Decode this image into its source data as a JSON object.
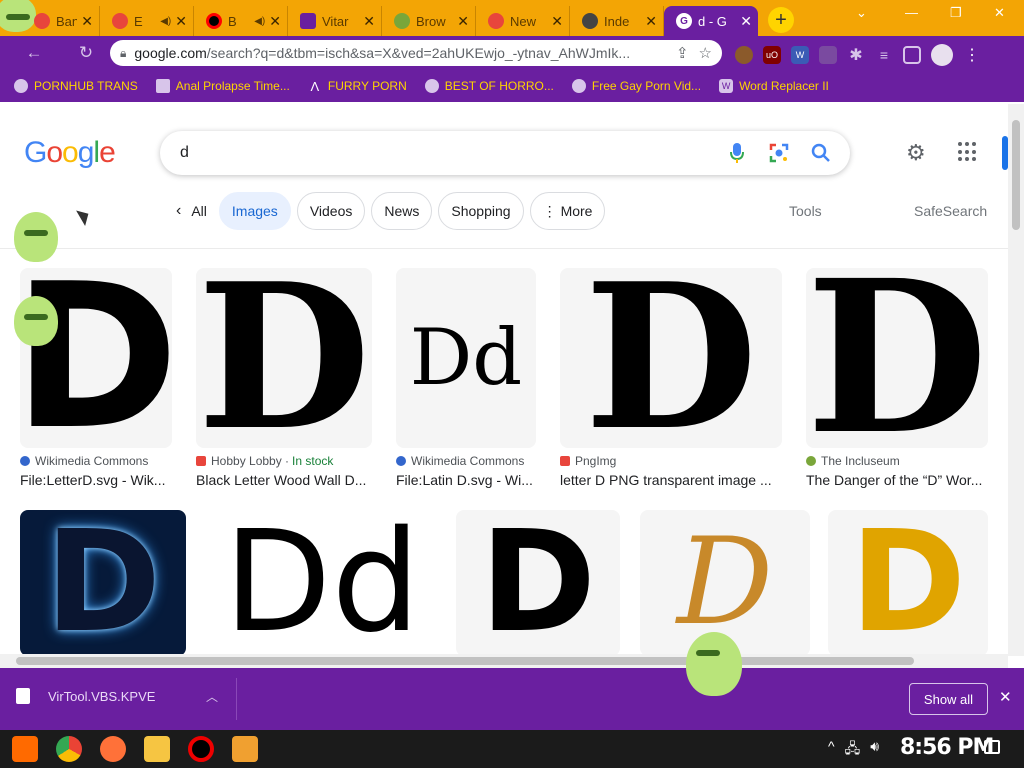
{
  "browser": {
    "tabs": [
      {
        "label": "Bandi",
        "color": "#e8453c"
      },
      {
        "label": "E",
        "color": "#e8453c"
      },
      {
        "label": "B",
        "color": "#ff0000"
      },
      {
        "label": "Vitar",
        "color": "#6a1fa0"
      },
      {
        "label": "Brow",
        "color": "#7aa63a"
      },
      {
        "label": "New",
        "color": "#e8453c"
      },
      {
        "label": "Inde",
        "color": "#444444"
      },
      {
        "label": "d - G",
        "color": "#ffffff"
      }
    ],
    "omnibox": {
      "host": "google.com",
      "path": "/search?q=d&tbm=isch&sa=X&ved=2ahUKEwjo_-ytnav_AhWJmIk..."
    },
    "bookmarks": [
      "PORNHUB TRANS",
      "Anal Prolapse Time...",
      "FURRY PORN",
      "BEST OF HORRO...",
      "Free Gay Porn Vid...",
      "Word Replacer II"
    ]
  },
  "google": {
    "query": "d",
    "chips": {
      "back": "All",
      "items": [
        "Images",
        "Videos",
        "News",
        "Shopping",
        "More"
      ],
      "selected": "Images"
    },
    "tools": "Tools",
    "safesearch": "SafeSearch"
  },
  "results": {
    "row1": [
      {
        "glyph": "D",
        "source": "Wikimedia Commons",
        "stock": "",
        "title": "File:LetterD.svg - Wik..."
      },
      {
        "glyph": "D",
        "source": "Hobby Lobby ·",
        "stock": "In stock",
        "title": "Black Letter Wood Wall D..."
      },
      {
        "glyph": "Dd",
        "source": "Wikimedia Commons",
        "stock": "",
        "title": "File:Latin D.svg - Wi..."
      },
      {
        "glyph": "D",
        "source": "PngImg",
        "stock": "",
        "title": "letter D PNG transparent image ..."
      },
      {
        "glyph": "D",
        "source": "The Incluseum",
        "stock": "",
        "title": "The Danger of the “D” Wor..."
      }
    ],
    "row2": [
      "D",
      "Dd",
      "D",
      "D",
      "D"
    ]
  },
  "downloads": {
    "file": "VirTool.VBS.KPVE",
    "show_all": "Show all"
  },
  "taskbar": {
    "clock": "8:56 PM"
  }
}
